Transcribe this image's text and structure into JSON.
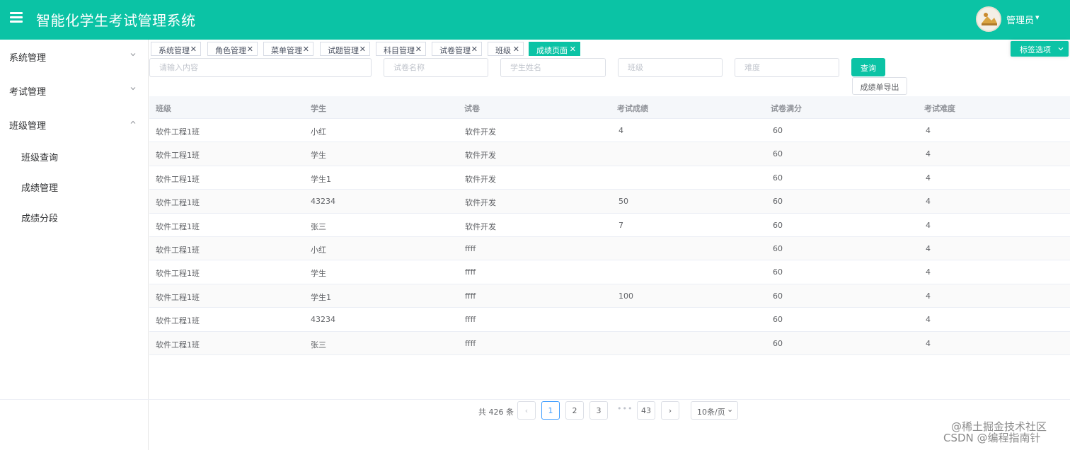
{
  "header": {
    "app_title": "智能化学生考试管理系统",
    "user_name": "管理员",
    "user_caret": "▾",
    "bg_color": "#0bc3a5"
  },
  "sidebar": {
    "groups": [
      {
        "label": "系统管理",
        "expanded": false
      },
      {
        "label": "考试管理",
        "expanded": false
      },
      {
        "label": "班级管理",
        "expanded": true
      }
    ],
    "sub_items": [
      {
        "label": "班级查询"
      },
      {
        "label": "成绩管理"
      },
      {
        "label": "成绩分段"
      }
    ]
  },
  "tabs": [
    {
      "label": "系统管理",
      "close": "✕"
    },
    {
      "label": "角色管理",
      "close": "✕"
    },
    {
      "label": "菜单管理",
      "close": "✕"
    },
    {
      "label": "试题管理",
      "close": "✕"
    },
    {
      "label": "科目管理",
      "close": "✕"
    },
    {
      "label": "试卷管理",
      "close": "✕"
    },
    {
      "label": "班级",
      "close": "✕"
    },
    {
      "label": "成绩页面",
      "close": "✕",
      "active": true
    }
  ],
  "tab_options_label": "标签选项",
  "filters": {
    "keyword_placeholder": "请输入内容",
    "paper_placeholder": "试卷名称",
    "student_placeholder": "学生姓名",
    "class_placeholder": "班级",
    "difficulty_placeholder": "难度",
    "query_label": "查询",
    "export_label": "成绩单导出"
  },
  "table": {
    "columns": [
      "班级",
      "学生",
      "试卷",
      "考试成绩",
      "试卷满分",
      "考试难度"
    ],
    "rows": [
      [
        "软件工程1班",
        "小红",
        "软件开发",
        "4",
        "60",
        "4"
      ],
      [
        "软件工程1班",
        "学生",
        "软件开发",
        "",
        "60",
        "4"
      ],
      [
        "软件工程1班",
        "学生1",
        "软件开发",
        "",
        "60",
        "4"
      ],
      [
        "软件工程1班",
        "43234",
        "软件开发",
        "50",
        "60",
        "4"
      ],
      [
        "软件工程1班",
        "张三",
        "软件开发",
        "7",
        "60",
        "4"
      ],
      [
        "软件工程1班",
        "小红",
        "ffff",
        "",
        "60",
        "4"
      ],
      [
        "软件工程1班",
        "学生",
        "ffff",
        "",
        "60",
        "4"
      ],
      [
        "软件工程1班",
        "学生1",
        "ffff",
        "100",
        "60",
        "4"
      ],
      [
        "软件工程1班",
        "43234",
        "ffff",
        "",
        "60",
        "4"
      ],
      [
        "软件工程1班",
        "张三",
        "ffff",
        "",
        "60",
        "4"
      ]
    ]
  },
  "pagination": {
    "total": "共 426 条",
    "prev": "‹",
    "next": "›",
    "pages": [
      "1",
      "2",
      "3"
    ],
    "current": "1",
    "more": "•••",
    "last": "43",
    "page_size": "10条/页",
    "page_size_caret": "⌄"
  },
  "watermark": {
    "line1": "@稀土掘金技术社区",
    "line2": "CSDN @编程指南针"
  }
}
